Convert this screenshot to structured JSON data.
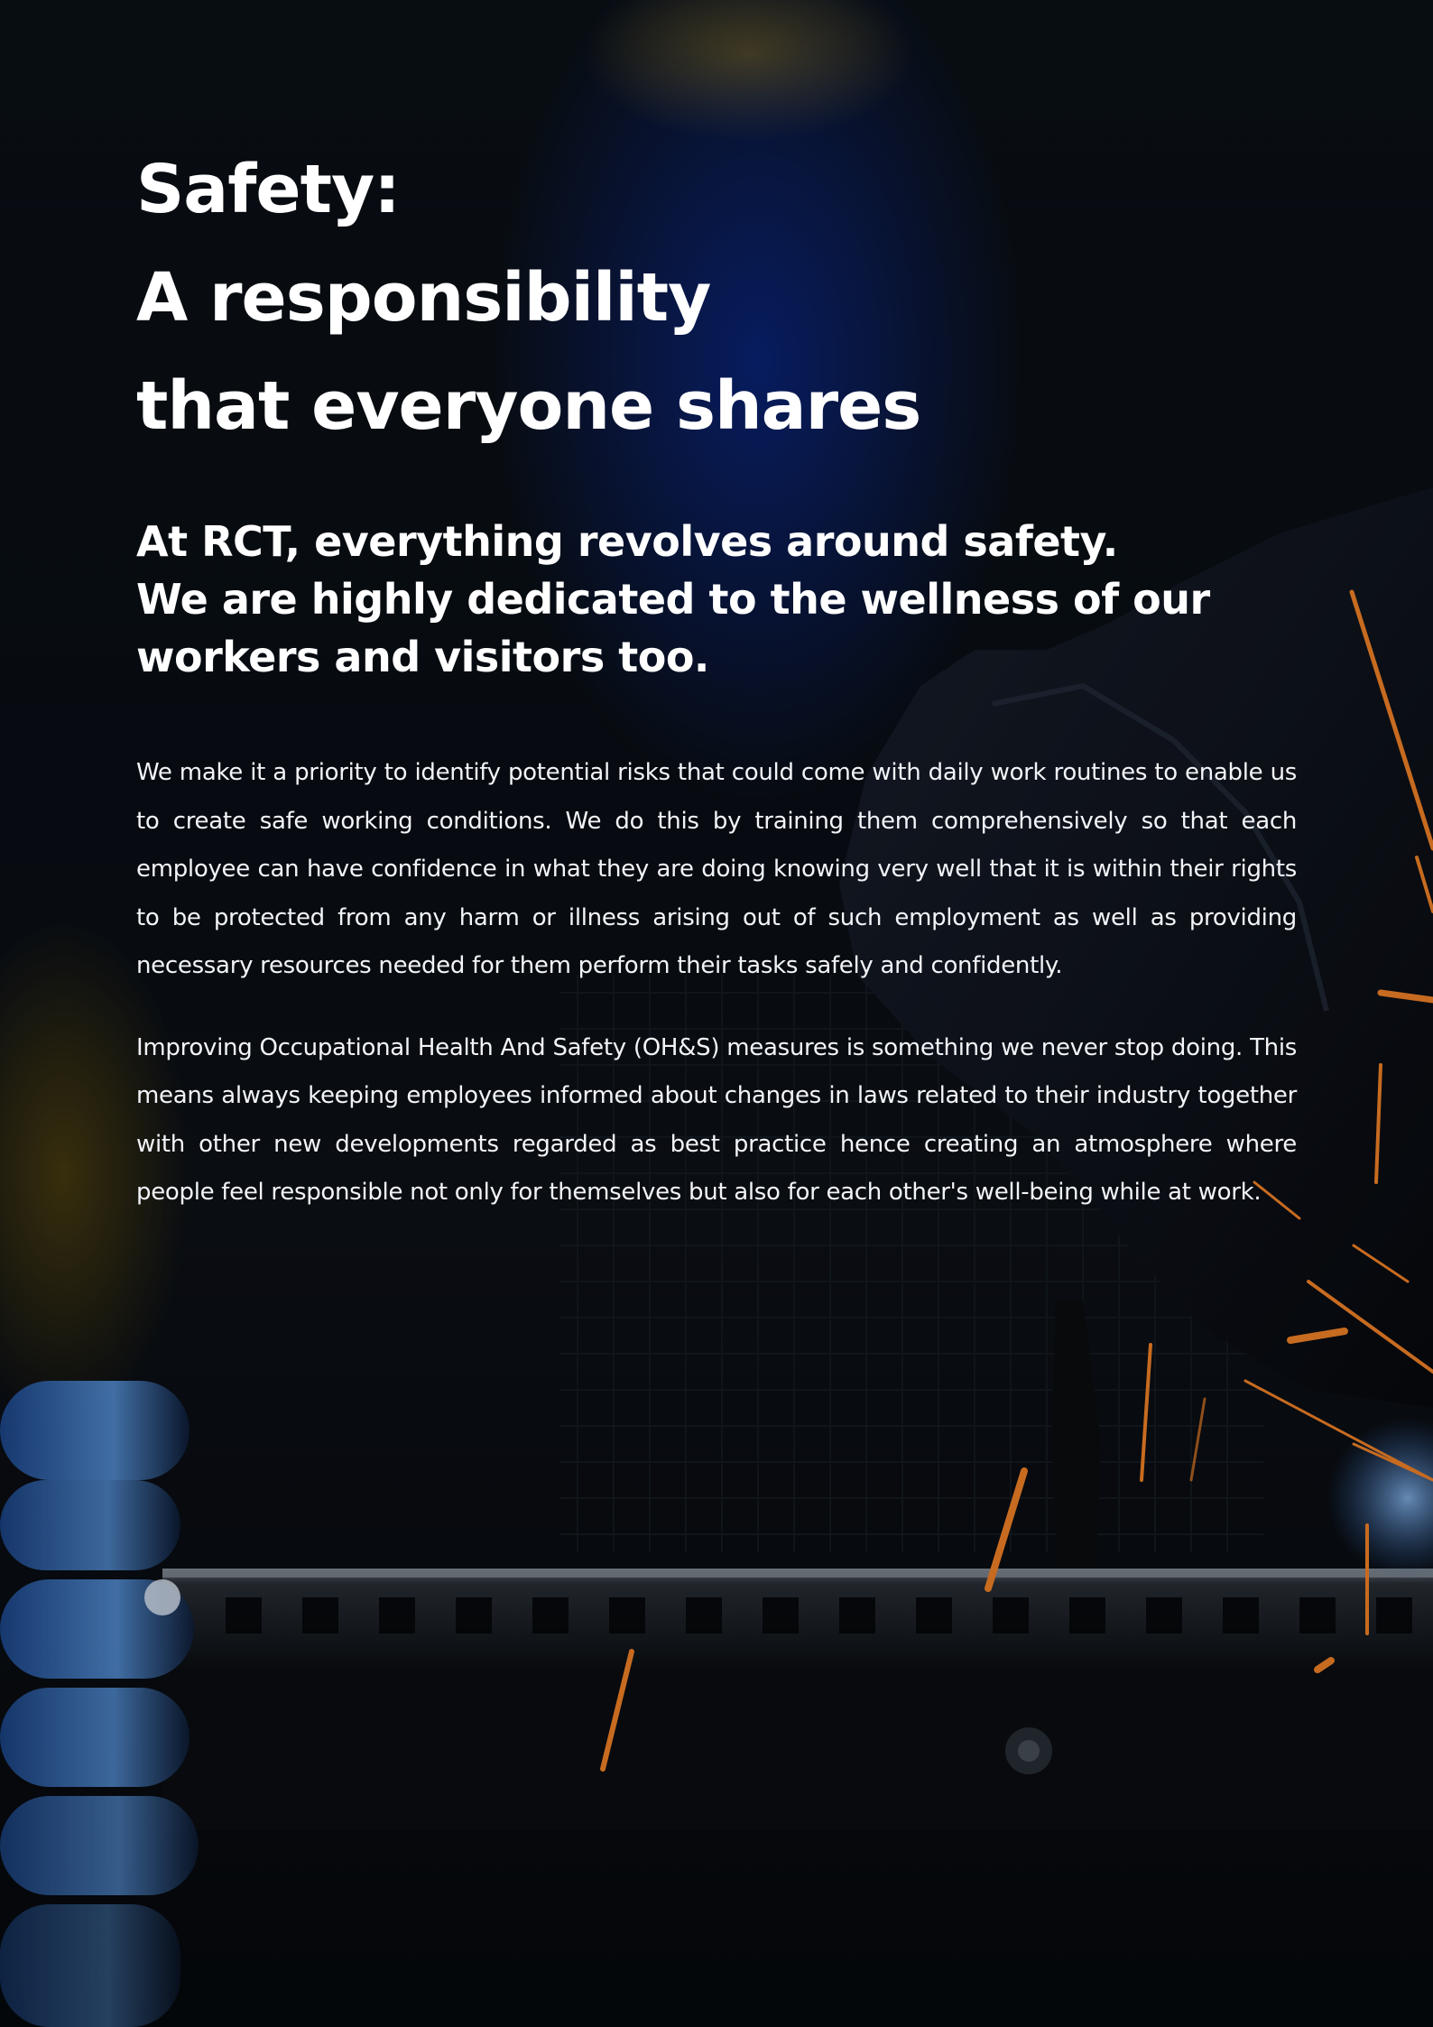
{
  "headline": {
    "line1": "Safety:",
    "line2": "A responsibility",
    "line3": "that everyone shares"
  },
  "subheading": {
    "line1": "At RCT, everything revolves around safety.",
    "line2": "We are highly dedicated to the wellness of our",
    "line3": "workers and visitors too."
  },
  "paragraphs": [
    "We make it a priority to identify potential risks that could come with daily work routines to enable us to create safe working conditions. We do this by training them comprehensively so that each employee can have confidence in what they are doing knowing very well that it is within their rights to be protected from any harm or illness arising out of such employment as well as providing necessary resources needed for them perform their tasks safely and confidently.",
    "Improving Occupational Health And Safety (OH&S) measures is something we never stop doing. This means always keeping employees informed about changes in laws related to their industry together with other new developments regarded as best practice hence creating an atmosphere where people feel responsible not only for themselves but also for each other's well-being while at work."
  ],
  "colors": {
    "text": "#ffffff",
    "spark": "#ff8a2a",
    "metal_blue": "#3d7fd6"
  }
}
